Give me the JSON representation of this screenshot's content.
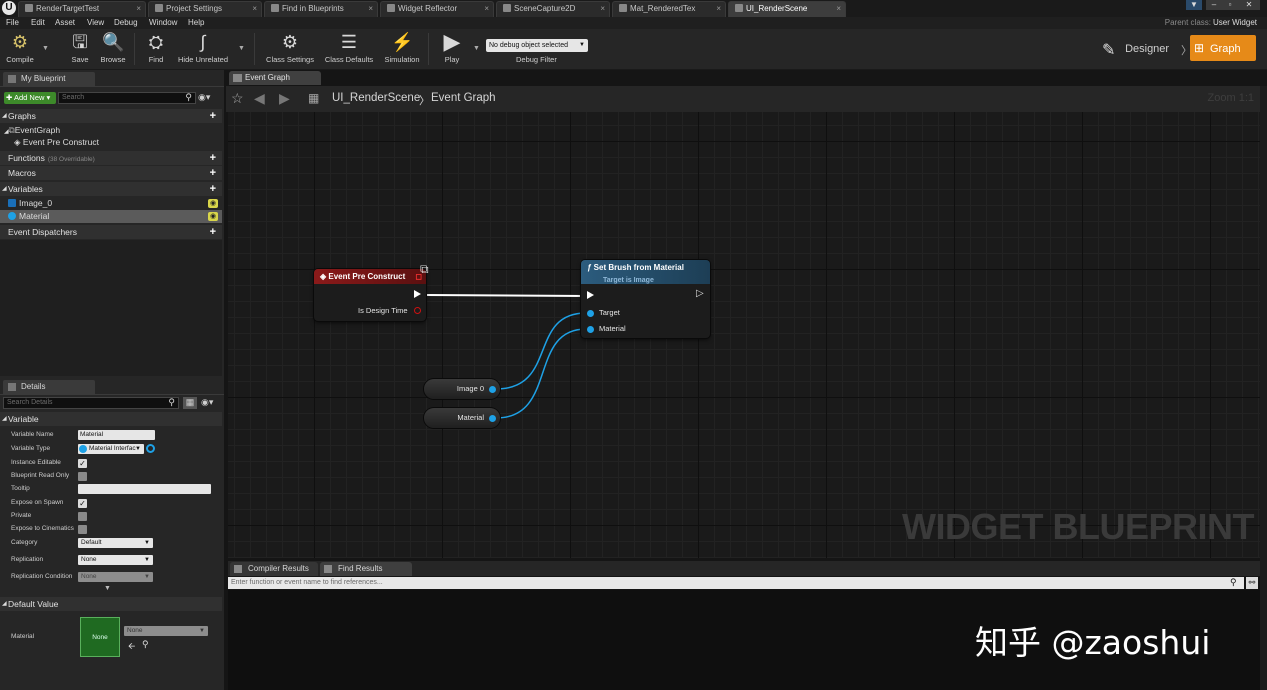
{
  "window": {
    "tabs": [
      {
        "label": "RenderTargetTest",
        "active": false
      },
      {
        "label": "Project Settings",
        "active": false
      },
      {
        "label": "Find in Blueprints",
        "active": false
      },
      {
        "label": "Widget Reflector",
        "active": false
      },
      {
        "label": "SceneCapture2D",
        "active": false
      },
      {
        "label": "Mat_RenderedTex",
        "active": false
      },
      {
        "label": "UI_RenderScene",
        "active": true
      }
    ],
    "parent_class_label": "Parent class:",
    "parent_class_value": "User Widget"
  },
  "menu": [
    "File",
    "Edit",
    "Asset",
    "View",
    "Debug",
    "Window",
    "Help"
  ],
  "toolbar": {
    "compile": "Compile",
    "save": "Save",
    "browse": "Browse",
    "find": "Find",
    "hide_unrelated": "Hide Unrelated",
    "class_settings": "Class Settings",
    "class_defaults": "Class Defaults",
    "simulation": "Simulation",
    "play": "Play",
    "debug_select": "No debug object selected",
    "debug_filter": "Debug Filter",
    "designer": "Designer",
    "graph": "Graph"
  },
  "my_blueprint": {
    "tab": "My Blueprint",
    "add_new": "Add New",
    "search_placeholder": "Search",
    "graphs_header": "Graphs",
    "event_graph": "EventGraph",
    "event_pre_construct": "Event Pre Construct",
    "functions_header": "Functions",
    "functions_note": "(38 Overridable)",
    "macros_header": "Macros",
    "variables_header": "Variables",
    "variables": [
      {
        "name": "Image_0",
        "color": "#1a6fb8"
      },
      {
        "name": "Material",
        "color": "#1ea1e6"
      }
    ],
    "dispatchers_header": "Event Dispatchers"
  },
  "details": {
    "tab": "Details",
    "search_placeholder": "Search Details",
    "variable_header": "Variable",
    "variable_name_label": "Variable Name",
    "variable_name_value": "Material",
    "variable_type_label": "Variable Type",
    "variable_type_value": "Material Interfac",
    "instance_editable_label": "Instance Editable",
    "instance_editable": true,
    "read_only_label": "Blueprint Read Only",
    "read_only": false,
    "tooltip_label": "Tooltip",
    "tooltip_value": "",
    "expose_spawn_label": "Expose on Spawn",
    "expose_spawn": true,
    "private_label": "Private",
    "private": false,
    "expose_cinematics_label": "Expose to Cinematics",
    "expose_cinematics": false,
    "category_label": "Category",
    "category_value": "Default",
    "replication_label": "Replication",
    "replication_value": "None",
    "replication_condition_label": "Replication Condition",
    "replication_condition_value": "None",
    "default_value_header": "Default Value",
    "default_material_label": "Material",
    "thumb_label": "None",
    "default_select": "None"
  },
  "graph": {
    "tab": "Event Graph",
    "breadcrumb_bp": "UI_RenderScene",
    "breadcrumb_sep": "〉",
    "breadcrumb_graph": "Event Graph",
    "zoom": "Zoom 1:1",
    "watermark": "WIDGET BLUEPRINT",
    "nodes": {
      "event_title": "Event Pre Construct",
      "event_pin": "Is Design Time",
      "func_title": "Set Brush from Material",
      "func_subtitle": "Target is Image",
      "func_pin_target": "Target",
      "func_pin_material": "Material",
      "var_image": "Image 0",
      "var_material": "Material"
    }
  },
  "bottom": {
    "compiler_tab": "Compiler Results",
    "find_tab": "Find Results",
    "find_placeholder": "Enter function or event name to find references..."
  },
  "overlay_watermark": "知乎 @zaoshui",
  "colors": {
    "accent": "#e68a18",
    "event_node": "#8b1a1a",
    "function_node": "#2c5c7e",
    "object_pin": "#1ea1e6"
  }
}
